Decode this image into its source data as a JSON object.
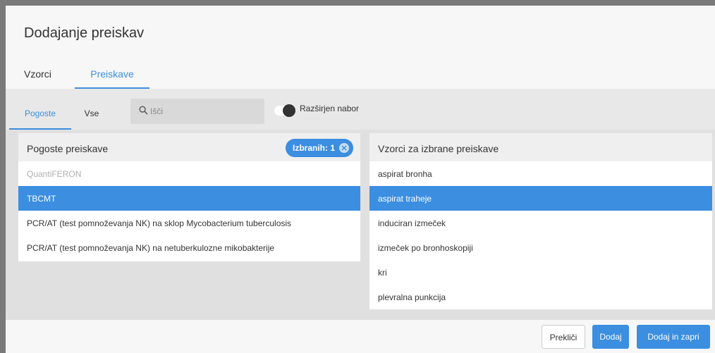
{
  "dialog": {
    "title": "Dodajanje preiskav",
    "tabs": [
      {
        "label": "Vzorci"
      },
      {
        "label": "Preiskave"
      }
    ]
  },
  "subbar": {
    "tabs": [
      {
        "label": "Pogoste"
      },
      {
        "label": "Vse"
      }
    ],
    "search": {
      "placeholder": "Išči",
      "value": ""
    },
    "toggle_label": "Razširjen nabor"
  },
  "left_panel": {
    "title": "Pogoste preiskave",
    "badge": "Izbranih: 1",
    "items": [
      {
        "label": "QuantiFERON",
        "state": "disabled"
      },
      {
        "label": "TBCMT",
        "state": "selected"
      },
      {
        "label": "PCR/AT (test pomnoževanja NK) na sklop Mycobacterium tuberculosis",
        "state": "normal"
      },
      {
        "label": "PCR/AT (test pomnoževanja NK) na netuberkulozne mikobakterije",
        "state": "normal"
      }
    ]
  },
  "right_panel": {
    "title": "Vzorci za izbrane preiskave",
    "items": [
      {
        "label": "aspirat bronha",
        "state": "normal"
      },
      {
        "label": "aspirat traheje",
        "state": "selected"
      },
      {
        "label": "induciran izmeček",
        "state": "normal"
      },
      {
        "label": "izmeček po bronhoskopiji",
        "state": "normal"
      },
      {
        "label": "kri",
        "state": "normal"
      },
      {
        "label": "plevralna punkcija",
        "state": "normal"
      }
    ]
  },
  "footer": {
    "cancel_label": "Prekliči",
    "add_label": "Dodaj",
    "add_close_label": "Dodaj in zapri"
  },
  "colors": {
    "accent": "#3b8ee0",
    "overlay": "#7a7a7a"
  }
}
